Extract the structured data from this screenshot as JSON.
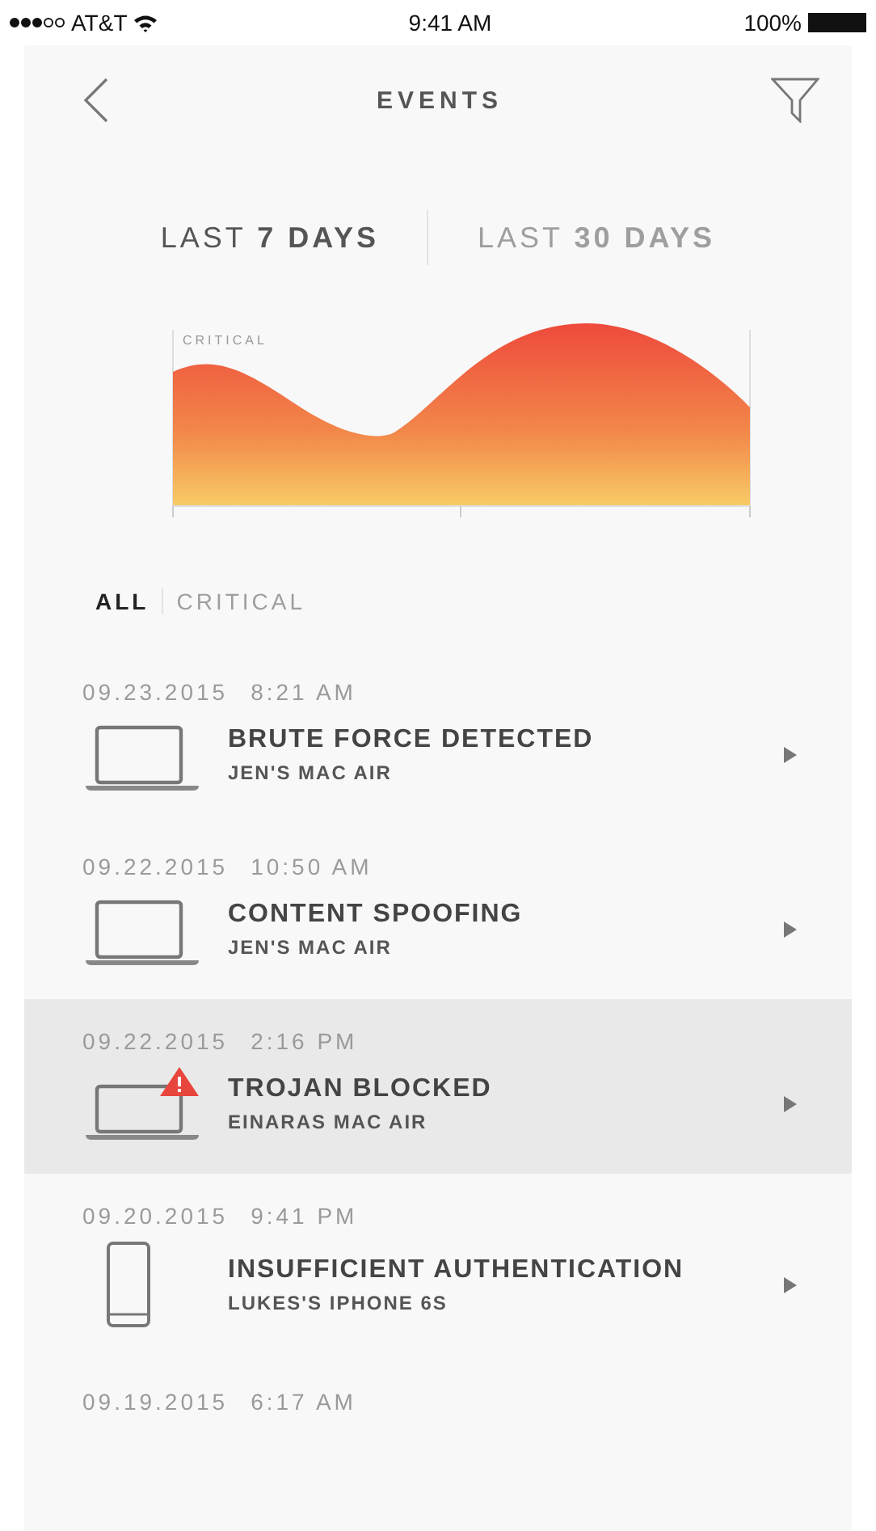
{
  "status_bar": {
    "carrier": "AT&T",
    "time": "9:41 AM",
    "battery": "100%"
  },
  "nav": {
    "title": "EVENTS"
  },
  "range_tabs": [
    {
      "label": "LAST **7 DAYS**",
      "selected": true
    },
    {
      "label": "LAST **30 DAYS**",
      "selected": false
    }
  ],
  "chart": {
    "label": "CRITICAL"
  },
  "filter_tabs": [
    {
      "label": "ALL",
      "selected": true
    },
    {
      "label": "CRITICAL",
      "selected": false
    }
  ],
  "events": [
    {
      "date": "09.23.2015",
      "time": "8:21 AM",
      "title": "BRUTE FORCE DETECTED",
      "device": "JEN'S MAC AIR",
      "kind": "laptop",
      "alert": false,
      "selected": false
    },
    {
      "date": "09.22.2015",
      "time": "10:50 AM",
      "title": "CONTENT SPOOFING",
      "device": "JEN'S MAC AIR",
      "kind": "laptop",
      "alert": false,
      "selected": false
    },
    {
      "date": "09.22.2015",
      "time": "2:16 PM",
      "title": "TROJAN BLOCKED",
      "device": "EINARAS MAC AIR",
      "kind": "laptop",
      "alert": true,
      "selected": true
    },
    {
      "date": "09.20.2015",
      "time": "9:41 PM",
      "title": "INSUFFICIENT AUTHENTICATION",
      "device": "LUKES'S IPHONE 6S",
      "kind": "phone",
      "selected": false
    },
    {
      "date": "09.19.2015",
      "time": "6:17 AM"
    }
  ]
}
